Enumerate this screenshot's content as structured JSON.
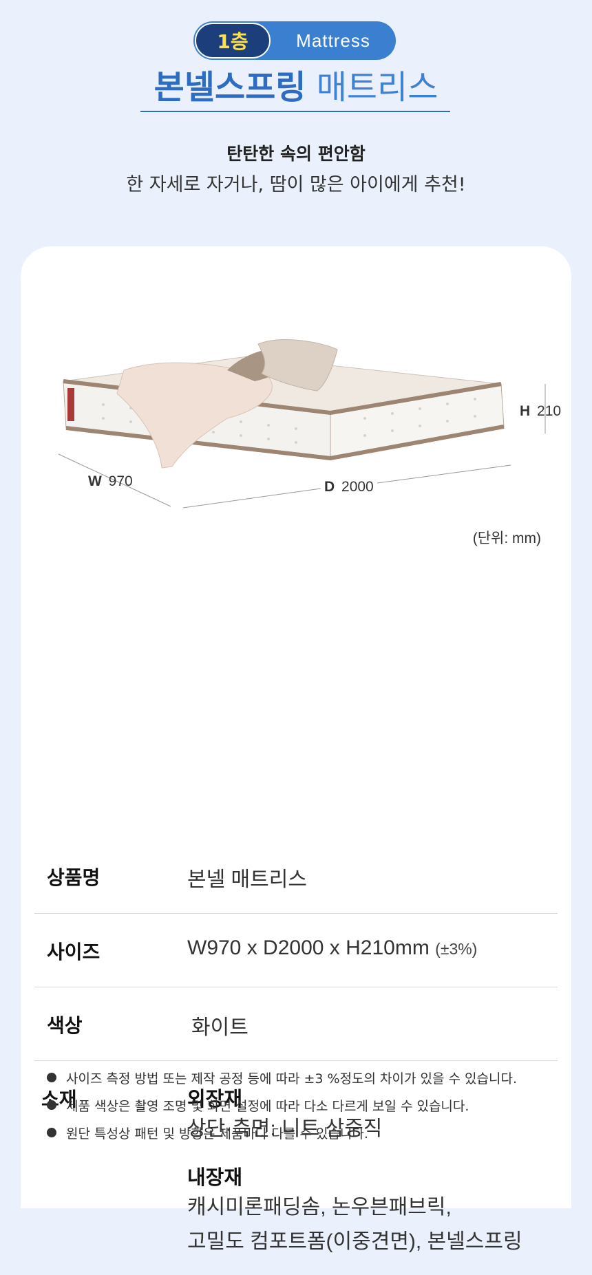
{
  "header": {
    "floor_badge": "1층",
    "kind_badge": "Mattress",
    "title_strong": "본넬스프링",
    "title_light": "매트리스",
    "subtitle": "탄탄한 속의 편안함",
    "description": "한 자세로 자거나, 땀이 많은 아이에게 추천!"
  },
  "dimensions": {
    "width_key": "W",
    "width_val": "970",
    "depth_key": "D",
    "depth_val": "2000",
    "height_key": "H",
    "height_val": "210",
    "unit_note": "(단위: mm)"
  },
  "spec": {
    "name_label": "상품명",
    "name_value": "본넬 매트리스",
    "size_label": "사이즈",
    "size_value": "W970 x D2000 x H210mm",
    "size_tolerance": "(±3%)",
    "color_label": "색상",
    "color_value": "화이트",
    "material_label": "소재",
    "outer_title": "외장재",
    "outer_line": "상단·측면: 니트 삼중직",
    "inner_title": "내장재",
    "inner_line1": "캐시미론패딩솜, 논우븐패브릭,",
    "inner_line2": "고밀도 컴포트폼(이중견면), 본넬스프링"
  },
  "notes": [
    "사이즈 측정 방법 또는 제작 공정 등에 따라 ±3 %정도의 차이가 있을 수 있습니다.",
    "제품 색상은 촬영 조명 및 화면 설정에 따라 다소 다르게 보일 수 있습니다.",
    "원단 특성상 패턴 및 방향은 제품마다 다를 수 있습니다."
  ],
  "colors": {
    "background": "#eaf1fd",
    "accent_blue": "#2d6cc0",
    "badge_dark": "#1c3f7c",
    "badge_yellow": "#ffe04a"
  }
}
